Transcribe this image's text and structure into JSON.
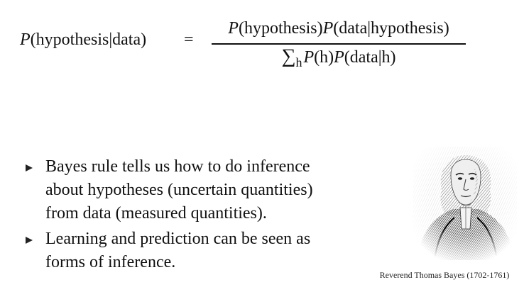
{
  "formula": {
    "lhs": {
      "func": "P",
      "args": "(hypothesis|data)"
    },
    "equals": "=",
    "numerator": {
      "p1": "P",
      "args1": "(hypothesis)",
      "p2": "P",
      "args2": "(data|hypothesis)"
    },
    "denominator": {
      "sum": "∑",
      "sum_index": "h",
      "p1": "P",
      "args1": "(h)",
      "p2": "P",
      "args2": "(data|h)"
    }
  },
  "bullets": [
    {
      "lines": [
        "Bayes rule tells us how to do inference",
        "about hypotheses (uncertain quantities)",
        "from data (measured quantities)."
      ]
    },
    {
      "lines": [
        "Learning and prediction can be seen as",
        "forms of inference."
      ]
    }
  ],
  "portrait": {
    "icon": "engraved-portrait",
    "caption": "Reverend Thomas Bayes (1702-1761)"
  }
}
